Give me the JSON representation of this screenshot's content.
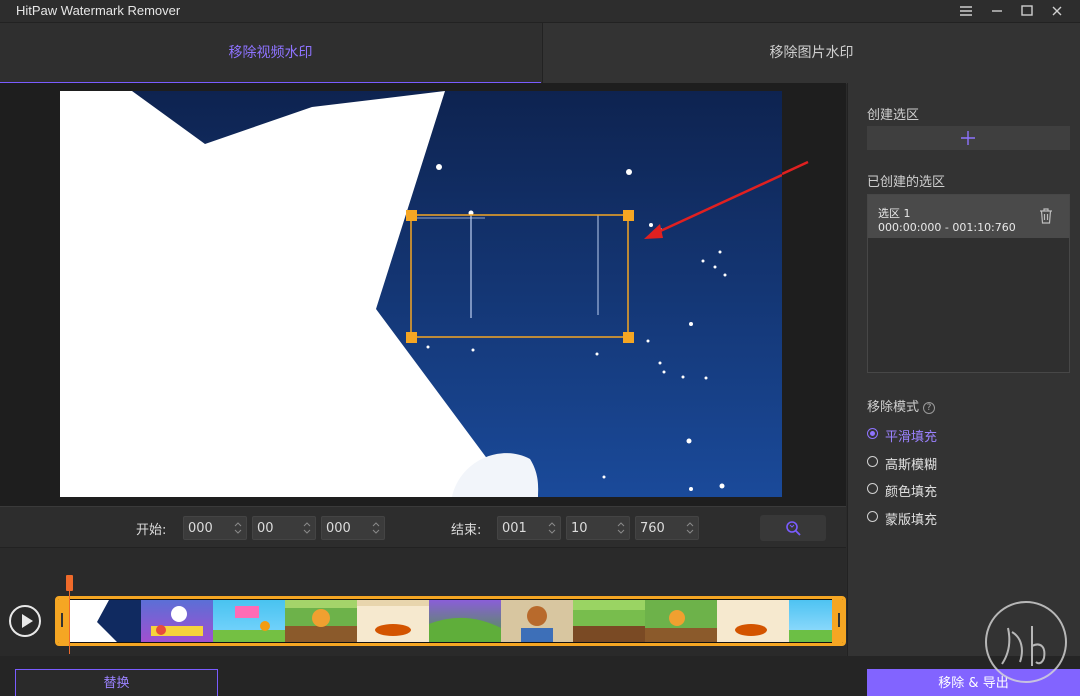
{
  "app": {
    "title": "HitPaw Watermark Remover"
  },
  "tabs": [
    {
      "label": "移除视频水印",
      "active": true
    },
    {
      "label": "移除图片水印",
      "active": false
    }
  ],
  "time": {
    "start_label": "开始:",
    "start": [
      "000",
      "00",
      "000"
    ],
    "end_label": "结束:",
    "end": [
      "001",
      "10",
      "760"
    ]
  },
  "panel": {
    "create_label": "创建选区",
    "created_label": "已创建的选区",
    "selections": [
      {
        "name": "选区 1",
        "range": "000:00:000 - 001:10:760"
      }
    ],
    "mode_label": "移除模式",
    "help_glyph": "?",
    "modes": [
      {
        "label": "平滑填充",
        "selected": true
      },
      {
        "label": "高斯模糊",
        "selected": false
      },
      {
        "label": "颜色填充",
        "selected": false
      },
      {
        "label": "蒙版填充",
        "selected": false
      }
    ]
  },
  "buttons": {
    "replace": "替换",
    "export": "移除 & 导出"
  },
  "colors": {
    "accent": "#8264ff",
    "selection_box": "#f5a623",
    "playhead": "#ef6a2a",
    "arrow": "#e02020"
  }
}
